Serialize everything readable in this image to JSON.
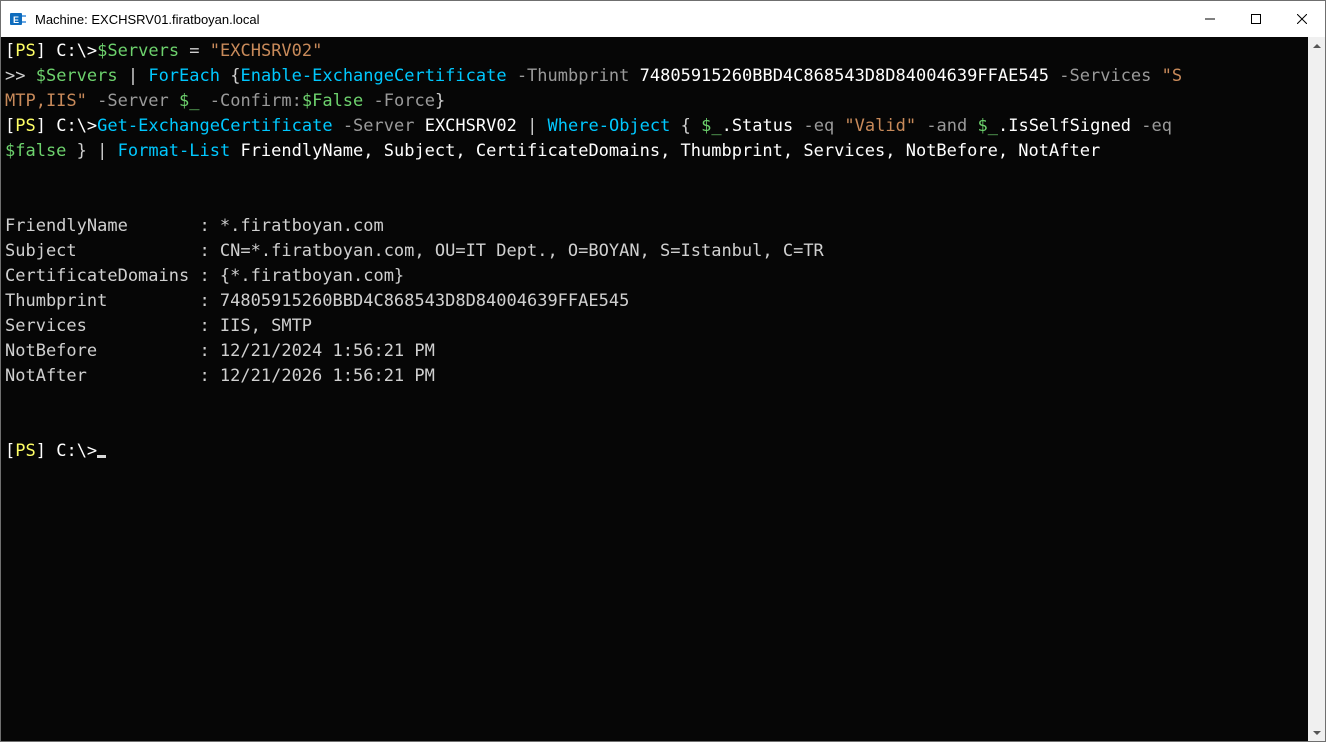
{
  "window": {
    "title": "Machine: EXCHSRV01.firatboyan.local",
    "icon_name": "exchange-app-icon"
  },
  "terminal": {
    "line1": {
      "prompt_open": "[",
      "prompt_ps": "PS",
      "prompt_close": "]",
      "path": " C:\\>",
      "var": "$Servers",
      "eq": " = ",
      "str": "\"EXCHSRV02\""
    },
    "line2": {
      "cont": ">> ",
      "var": "$Servers",
      "pipe": " | ",
      "foreach": "ForEach",
      "brace_open": " {",
      "cmd": "Enable-ExchangeCertificate",
      "p_thumb": " -Thumbprint",
      "v_thumb": " 74805915260BBD4C868543D8D84004639FFAE545",
      "p_svc": " -Services",
      "v_svc_open": " \"S",
      "v_svc_rest": "MTP,IIS\"",
      "p_server": " -Server",
      "v_server": " $_",
      "p_confirm": " -Confirm:",
      "v_confirm": "$False",
      "p_force": " -Force",
      "brace_close": "}"
    },
    "line3": {
      "prompt_open": "[",
      "prompt_ps": "PS",
      "prompt_close": "]",
      "path": " C:\\>",
      "cmd": "Get-ExchangeCertificate",
      "p_server": " -Server",
      "v_server": " EXCHSRV02",
      "pipe1": " | ",
      "where": "Where-Object",
      "brace_open": " { ",
      "auto1": "$_",
      "prop1": ".Status",
      "op_eq": " -eq",
      "str_valid": " \"Valid\"",
      "op_and": " -and",
      "auto2": " $_",
      "prop2": ".IsSelfSigned",
      "op_eq2": " -eq ",
      "false": "$false",
      "brace_close": " }",
      "pipe2": " | ",
      "fmt": "Format-List",
      "props": " FriendlyName, Subject, CertificateDomains, Thumbprint, Services, NotBefore, NotAfter"
    },
    "output": {
      "FriendlyName": "FriendlyName       : *.firatboyan.com",
      "Subject": "Subject            : CN=*.firatboyan.com, OU=IT Dept., O=BOYAN, S=Istanbul, C=TR",
      "CertificateDomains": "CertificateDomains : {*.firatboyan.com}",
      "Thumbprint": "Thumbprint         : 74805915260BBD4C868543D8D84004639FFAE545",
      "Services": "Services           : IIS, SMTP",
      "NotBefore": "NotBefore          : 12/21/2024 1:56:21 PM",
      "NotAfter": "NotAfter           : 12/21/2026 1:56:21 PM"
    },
    "prompt_final": {
      "prompt_open": "[",
      "prompt_ps": "PS",
      "prompt_close": "]",
      "path": " C:\\>"
    }
  }
}
